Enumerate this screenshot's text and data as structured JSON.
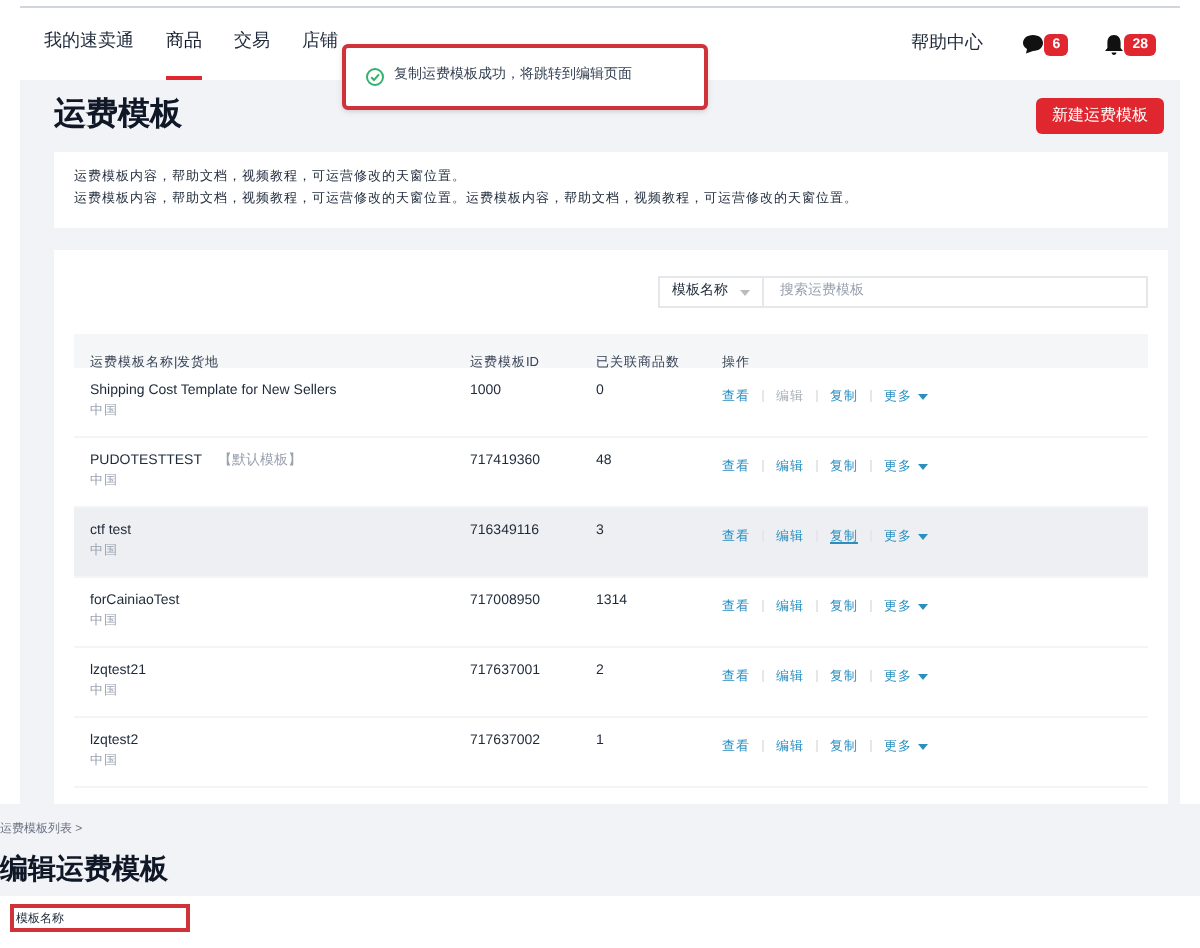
{
  "nav": {
    "items": [
      {
        "label": "我的速卖通",
        "selected": false
      },
      {
        "label": "商品",
        "selected": true
      },
      {
        "label": "交易",
        "selected": false
      },
      {
        "label": "店铺",
        "selected": false
      }
    ],
    "help": "帮助中心",
    "message_count": "6",
    "notice_count": "28"
  },
  "toast": {
    "text": "复制运费模板成功，将跳转到编辑页面"
  },
  "page_title": "运费模板",
  "new_button": "新建运费模板",
  "info_lines": [
    "运费模板内容，帮助文档，视频教程，可运营修改的天窗位置。",
    "运费模板内容，帮助文档，视频教程，可运营修改的天窗位置。运费模板内容，帮助文档，视频教程，可运营修改的天窗位置。"
  ],
  "search": {
    "select": "模板名称",
    "placeholder": "搜索运费模板"
  },
  "table": {
    "columns": [
      "运费模板名称|发货地",
      "运费模板ID",
      "已关联商品数",
      "操作"
    ],
    "rows": [
      {
        "name": "Shipping Cost Template for New Sellers",
        "origin": "中国",
        "id": "1000",
        "count": "0",
        "highlighted": false,
        "actions": [
          {
            "label": "查看",
            "disabled": false,
            "hovered": false
          },
          {
            "label": "编辑",
            "disabled": true,
            "hovered": false
          },
          {
            "label": "复制",
            "disabled": false,
            "hovered": false
          },
          {
            "label": "更多",
            "disabled": false,
            "hovered": false
          }
        ]
      },
      {
        "name": "PUDOTESTTEST",
        "tag": "【默认模板】",
        "origin": "中国",
        "id": "717419360",
        "count": "48",
        "highlighted": false,
        "actions": [
          {
            "label": "查看",
            "disabled": false,
            "hovered": false
          },
          {
            "label": "编辑",
            "disabled": false,
            "hovered": false
          },
          {
            "label": "复制",
            "disabled": false,
            "hovered": false
          },
          {
            "label": "更多",
            "disabled": false,
            "hovered": false
          }
        ]
      },
      {
        "name": "ctf test",
        "origin": "中国",
        "id": "716349116",
        "count": "3",
        "highlighted": true,
        "actions": [
          {
            "label": "查看",
            "disabled": false,
            "hovered": false
          },
          {
            "label": "编辑",
            "disabled": false,
            "hovered": false
          },
          {
            "label": "复制",
            "disabled": false,
            "hovered": true
          },
          {
            "label": "更多",
            "disabled": false,
            "hovered": false
          }
        ]
      },
      {
        "name": "forCainiaoTest",
        "origin": "中国",
        "id": "717008950",
        "count": "1314",
        "highlighted": false,
        "actions": [
          {
            "label": "查看",
            "disabled": false,
            "hovered": false
          },
          {
            "label": "编辑",
            "disabled": false,
            "hovered": false
          },
          {
            "label": "复制",
            "disabled": false,
            "hovered": false
          },
          {
            "label": "更多",
            "disabled": false,
            "hovered": false
          }
        ]
      },
      {
        "name": "lzqtest21",
        "origin": "中国",
        "id": "717637001",
        "count": "2",
        "highlighted": false,
        "actions": [
          {
            "label": "查看",
            "disabled": false,
            "hovered": false
          },
          {
            "label": "编辑",
            "disabled": false,
            "hovered": false
          },
          {
            "label": "复制",
            "disabled": false,
            "hovered": false
          },
          {
            "label": "更多",
            "disabled": false,
            "hovered": false
          }
        ]
      },
      {
        "name": "lzqtest2",
        "origin": "中国",
        "id": "717637002",
        "count": "1",
        "highlighted": false,
        "actions": [
          {
            "label": "查看",
            "disabled": false,
            "hovered": false
          },
          {
            "label": "编辑",
            "disabled": false,
            "hovered": false
          },
          {
            "label": "复制",
            "disabled": false,
            "hovered": false
          },
          {
            "label": "更多",
            "disabled": false,
            "hovered": false
          }
        ]
      }
    ]
  },
  "edit_page": {
    "breadcrumb": "运费模板列表 >",
    "title": "编辑运费模板",
    "field_label": "模板名称"
  }
}
